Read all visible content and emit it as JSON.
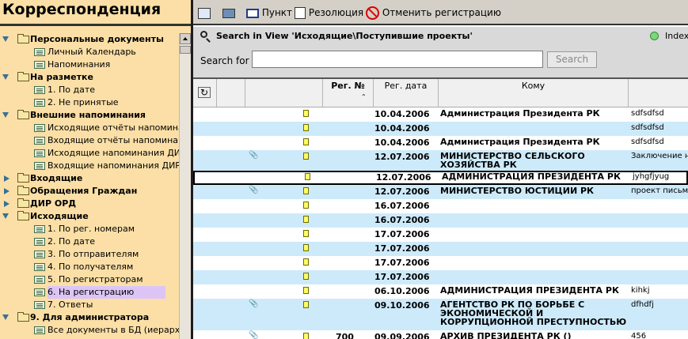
{
  "navigator": {
    "title": "Корреспонденция",
    "items": [
      {
        "label": "Персональные документы",
        "level": 0,
        "kind": "folder",
        "state": "open",
        "bold": true
      },
      {
        "label": "Личный Календарь",
        "level": 1,
        "kind": "view"
      },
      {
        "label": "Напоминания",
        "level": 1,
        "kind": "view"
      },
      {
        "label": "На разметке",
        "level": 0,
        "kind": "folder",
        "state": "open",
        "bold": true
      },
      {
        "label": "1. По дате",
        "level": 1,
        "kind": "view"
      },
      {
        "label": "2. Не принятые",
        "level": 1,
        "kind": "view"
      },
      {
        "label": "Внешние напоминания",
        "level": 0,
        "kind": "folder",
        "state": "open",
        "bold": true
      },
      {
        "label": "Исходящие отчёты напоминани",
        "level": 1,
        "kind": "view"
      },
      {
        "label": "Входящие отчёты напоминани",
        "level": 1,
        "kind": "view"
      },
      {
        "label": "Исходящие напоминания ДИРО",
        "level": 1,
        "kind": "view"
      },
      {
        "label": "Входящие напоминания ДИРОР",
        "level": 1,
        "kind": "view"
      },
      {
        "label": "Входящие",
        "level": 0,
        "kind": "folder",
        "state": "closed",
        "bold": true
      },
      {
        "label": "Обращения Граждан",
        "level": 0,
        "kind": "folder",
        "state": "closed",
        "bold": true
      },
      {
        "label": "ДИР ОРД",
        "level": 0,
        "kind": "folder",
        "state": "closed",
        "bold": true
      },
      {
        "label": "Исходящие",
        "level": 0,
        "kind": "folder",
        "state": "open",
        "bold": true
      },
      {
        "label": "1. По рег. номерам",
        "level": 1,
        "kind": "view"
      },
      {
        "label": "2. По дате",
        "level": 1,
        "kind": "view"
      },
      {
        "label": "3. По отправителям",
        "level": 1,
        "kind": "view"
      },
      {
        "label": "4. По получателям",
        "level": 1,
        "kind": "view"
      },
      {
        "label": "5. По регистраторам",
        "level": 1,
        "kind": "view"
      },
      {
        "label": "6. На регистрацию",
        "level": 1,
        "kind": "view",
        "selected": true
      },
      {
        "label": "7. Ответы",
        "level": 1,
        "kind": "view"
      },
      {
        "label": "9. Для администратора",
        "level": 0,
        "kind": "folder",
        "state": "open",
        "bold": true
      },
      {
        "label": "Все документы в БД (иерархия",
        "level": 1,
        "kind": "view"
      }
    ]
  },
  "toolbar": {
    "punkt_label": "Пункт",
    "resolution_label": "Резолюция",
    "cancel_label": "Отменить регистрацию",
    "icons": [
      "new-document-icon",
      "printer-icon",
      "punkt-icon",
      "resolution-icon",
      "cancel-registration-icon"
    ]
  },
  "search": {
    "title": "Search in View 'Исходящие\\Поступившие проекты'",
    "index_label": "Index",
    "for_label": "Search for",
    "input_value": "",
    "button_label": "Search"
  },
  "columns": {
    "reg_no": "Рег. №",
    "reg_date": "Рег. дата",
    "to": "Кому"
  },
  "rows": [
    {
      "date": "10.04.2006",
      "to": "Администрация Президента РК",
      "note": "sdfsdfsd",
      "clip": false
    },
    {
      "date": "10.04.2006",
      "to": "",
      "note": "sdfsdfsd",
      "clip": false
    },
    {
      "date": "10.04.2006",
      "to": "Администрация Президента РК",
      "note": "sdfsdfsd",
      "clip": false
    },
    {
      "date": "12.07.2006",
      "to": "МИНИСТЕРСТВО СЕЛЬСКОГО ХОЗЯЙСТВА РК",
      "note": "Заключение на",
      "clip": true
    },
    {
      "date": "12.07.2006",
      "to": "АДМИНИСТРАЦИЯ ПРЕЗИДЕНТА РК",
      "note": "jyhgfjyug",
      "clip": false,
      "current": true
    },
    {
      "date": "12.07.2006",
      "to": "МИНИСТЕРСТВО ЮСТИЦИИ РК",
      "note": "проект письма",
      "clip": true
    },
    {
      "date": "16.07.2006",
      "to": "",
      "note": "",
      "clip": false
    },
    {
      "date": "16.07.2006",
      "to": "",
      "note": "",
      "clip": false
    },
    {
      "date": "17.07.2006",
      "to": "",
      "note": "",
      "clip": false
    },
    {
      "date": "17.07.2006",
      "to": "",
      "note": "",
      "clip": false
    },
    {
      "date": "17.07.2006",
      "to": "",
      "note": "",
      "clip": false
    },
    {
      "date": "17.07.2006",
      "to": "",
      "note": "",
      "clip": false
    },
    {
      "date": "06.10.2006",
      "to": "АДМИНИСТРАЦИЯ ПРЕЗИДЕНТА РК",
      "note": "kihkj",
      "clip": false
    },
    {
      "date": "09.10.2006",
      "to": "АГЕНТСТВО РК ПО БОРЬБЕ С ЭКОНОМИЧЕСКОЙ И КОРРУПЦИОННОЙ ПРЕСТУПНОСТЬЮ",
      "note": "dfhdfj",
      "clip": true
    },
    {
      "num": "700",
      "date": "09.09.2006",
      "to": "АРХИВ ПРЕЗИДЕНТА РК ()",
      "note": "456",
      "clip": true
    }
  ]
}
